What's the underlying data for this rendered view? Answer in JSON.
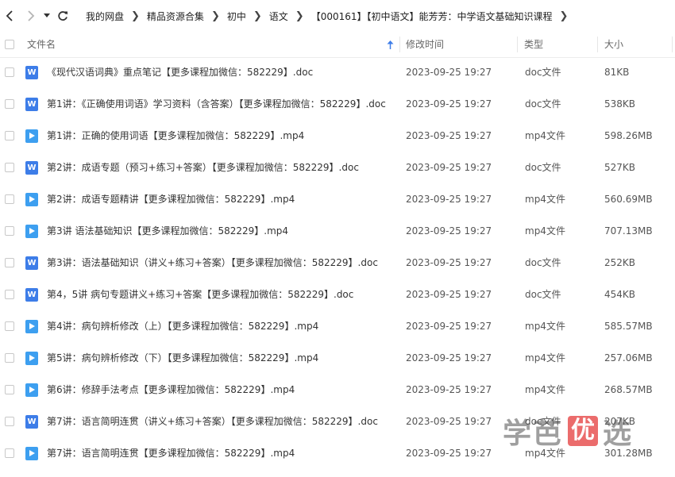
{
  "nav": {
    "breadcrumb": [
      "我的网盘",
      "精品资源合集",
      "初中",
      "语文",
      "【000161】【初中语文】能芳芳：中学语文基础知识课程"
    ]
  },
  "columns": {
    "name": "文件名",
    "modified": "修改时间",
    "type": "类型",
    "size": "大小"
  },
  "files": [
    {
      "kind": "doc",
      "name": "《现代汉语词典》重点笔记【更多课程加微信：582229】.doc",
      "modified": "2023-09-25 19:27",
      "type": "doc文件",
      "size": "81KB"
    },
    {
      "kind": "doc",
      "name": "第1讲：《正确使用词语》学习资料（含答案）【更多课程加微信：582229】.doc",
      "modified": "2023-09-25 19:27",
      "type": "doc文件",
      "size": "538KB"
    },
    {
      "kind": "mp4",
      "name": "第1讲：正确的使用词语【更多课程加微信：582229】.mp4",
      "modified": "2023-09-25 19:27",
      "type": "mp4文件",
      "size": "598.26MB"
    },
    {
      "kind": "doc",
      "name": "第2讲：成语专题（预习+练习+答案）【更多课程加微信：582229】.doc",
      "modified": "2023-09-25 19:27",
      "type": "doc文件",
      "size": "527KB"
    },
    {
      "kind": "mp4",
      "name": "第2讲：成语专题精讲【更多课程加微信：582229】.mp4",
      "modified": "2023-09-25 19:27",
      "type": "mp4文件",
      "size": "560.69MB"
    },
    {
      "kind": "mp4",
      "name": "第3讲 语法基础知识【更多课程加微信：582229】.mp4",
      "modified": "2023-09-25 19:27",
      "type": "mp4文件",
      "size": "707.13MB"
    },
    {
      "kind": "doc",
      "name": "第3讲：语法基础知识（讲义+练习+答案）【更多课程加微信：582229】.doc",
      "modified": "2023-09-25 19:27",
      "type": "doc文件",
      "size": "252KB"
    },
    {
      "kind": "doc",
      "name": "第4，5讲  病句专题讲义+练习+答案【更多课程加微信：582229】.doc",
      "modified": "2023-09-25 19:27",
      "type": "doc文件",
      "size": "454KB"
    },
    {
      "kind": "mp4",
      "name": "第4讲：病句辨析修改（上）【更多课程加微信：582229】.mp4",
      "modified": "2023-09-25 19:27",
      "type": "mp4文件",
      "size": "585.57MB"
    },
    {
      "kind": "mp4",
      "name": "第5讲：病句辨析修改（下）【更多课程加微信：582229】.mp4",
      "modified": "2023-09-25 19:27",
      "type": "mp4文件",
      "size": "257.06MB"
    },
    {
      "kind": "mp4",
      "name": "第6讲：修辞手法考点【更多课程加微信：582229】.mp4",
      "modified": "2023-09-25 19:27",
      "type": "mp4文件",
      "size": "268.57MB"
    },
    {
      "kind": "doc",
      "name": "第7讲：语言简明连贯（讲义+练习+答案）【更多课程加微信：582229】.doc",
      "modified": "2023-09-25 19:27",
      "type": "doc文件",
      "size": "207KB"
    },
    {
      "kind": "mp4",
      "name": "第7讲：语言简明连贯【更多课程加微信：582229】.mp4",
      "modified": "2023-09-25 19:27",
      "type": "mp4文件",
      "size": "301.28MB"
    }
  ],
  "icons": {
    "doc": "word-doc-icon",
    "mp4": "video-play-icon"
  },
  "watermark": {
    "text_left": "学芭",
    "text_box": "优",
    "text_right": "选"
  },
  "colors": {
    "doc_icon": "#3d7de8",
    "mp4_icon": "#3d9ff0",
    "sort_arrow": "#3d7de8"
  }
}
